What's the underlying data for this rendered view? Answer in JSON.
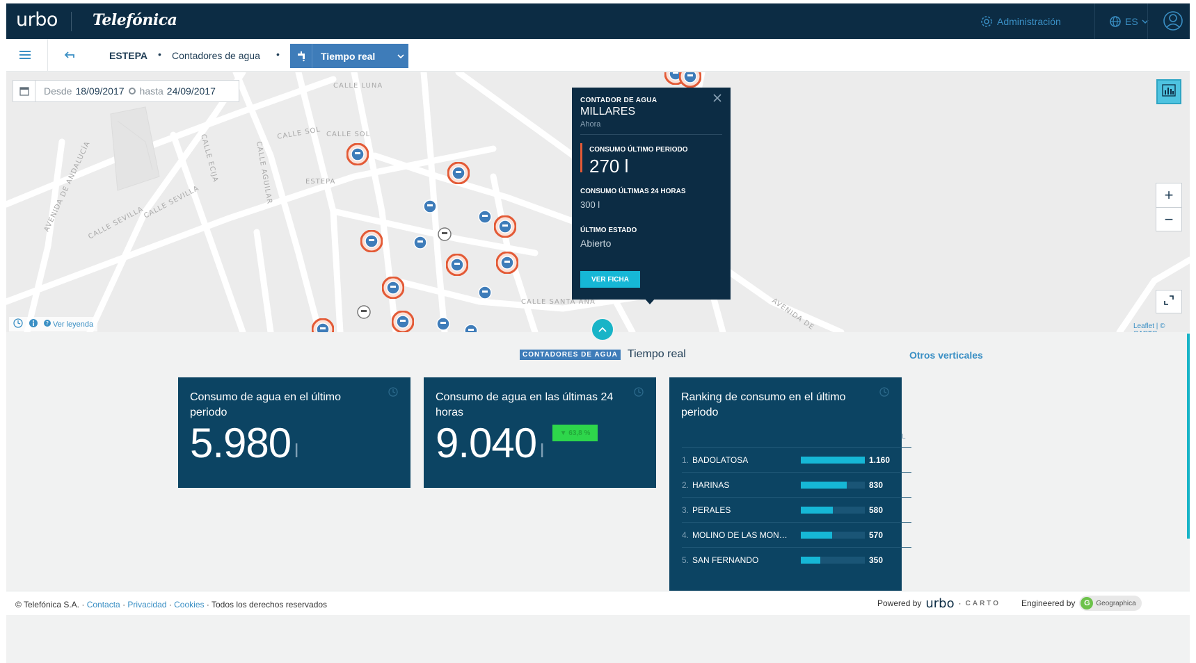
{
  "topbar": {
    "logo": "urbo",
    "brand": "Telefónica",
    "admin_label": "Administración",
    "lang_label": "ES"
  },
  "breadcrumb": {
    "city": "ESTEPA",
    "category": "Contadores de agua",
    "mode": "Tiempo real"
  },
  "date_filter": {
    "from_label": "Desde",
    "from_value": "18/09/2017",
    "to_label": "hasta",
    "to_value": "24/09/2017"
  },
  "map": {
    "legend_link": "Ver leyenda",
    "attribution": "Leaflet | © CARTO",
    "streets": [
      "CALLE LUNA",
      "CALLE SOL",
      "CALLE SOL",
      "ESTEPA",
      "CALLE SEVILLA",
      "CALLE SEVILLA",
      "AVENIDA DE ANDALUCÍA",
      "CALLE AGUILAR",
      "CALLE ECIJA",
      "CALLE SANTA ANA",
      "AVENIDA DE"
    ],
    "zoom_in": "+",
    "zoom_out": "−"
  },
  "popup": {
    "type_label": "CONTADOR DE AGUA",
    "name": "MILLARES",
    "time": "Ahora",
    "metric1_label": "CONSUMO ÚLTIMO PERIODO",
    "metric1_value": "270 l",
    "metric2_label": "CONSUMO ÚLTIMAS 24 HORAS",
    "metric2_value": "300 l",
    "metric3_label": "ÚLTIMO ESTADO",
    "metric3_value": "Abierto",
    "button": "VER FICHA"
  },
  "dashboard": {
    "section_badge": "CONTADORES DE AGUA",
    "section_sub": "Tiempo real",
    "other_verticals": "Otros verticales",
    "card1": {
      "title": "Consumo de agua en el último periodo",
      "value": "5.980",
      "unit": "l"
    },
    "card2": {
      "title": "Consumo de agua en las últimas 24 horas",
      "value": "9.040",
      "unit": "l",
      "trend": "▼ 63,8 %"
    },
    "card3": {
      "title": "Ranking de consumo en el último periodo",
      "unit": "L",
      "rows": [
        {
          "rank": "1.",
          "name": "BADOLATOSA",
          "value": "1.160",
          "amount": 1160
        },
        {
          "rank": "2.",
          "name": "HARINAS",
          "value": "830",
          "amount": 830
        },
        {
          "rank": "3.",
          "name": "PERALES",
          "value": "580",
          "amount": 580
        },
        {
          "rank": "4.",
          "name": "MOLINO DE LAS MON…",
          "value": "570",
          "amount": 570
        },
        {
          "rank": "5.",
          "name": "SAN FERNANDO",
          "value": "350",
          "amount": 350
        }
      ]
    }
  },
  "footer": {
    "copyright": "© Telefónica S.A.",
    "sep": "·",
    "contact": "Contacta",
    "privacy": "Privacidad",
    "cookies": "Cookies",
    "rights": "Todos los derechos reservados",
    "powered_by": "Powered by",
    "powered_logo": "urbo",
    "dot": "·",
    "carto": "CARTO",
    "engineered_by": "Engineered by",
    "geo": "Geographica",
    "geo_initial": "G"
  },
  "colors": {
    "navy": "#0c2c44",
    "card": "#0c4463",
    "accent": "#16b7d6",
    "marker_alert": "#e35a36",
    "marker_blue": "#3e7cb9",
    "trend_green": "#2ed64b"
  }
}
